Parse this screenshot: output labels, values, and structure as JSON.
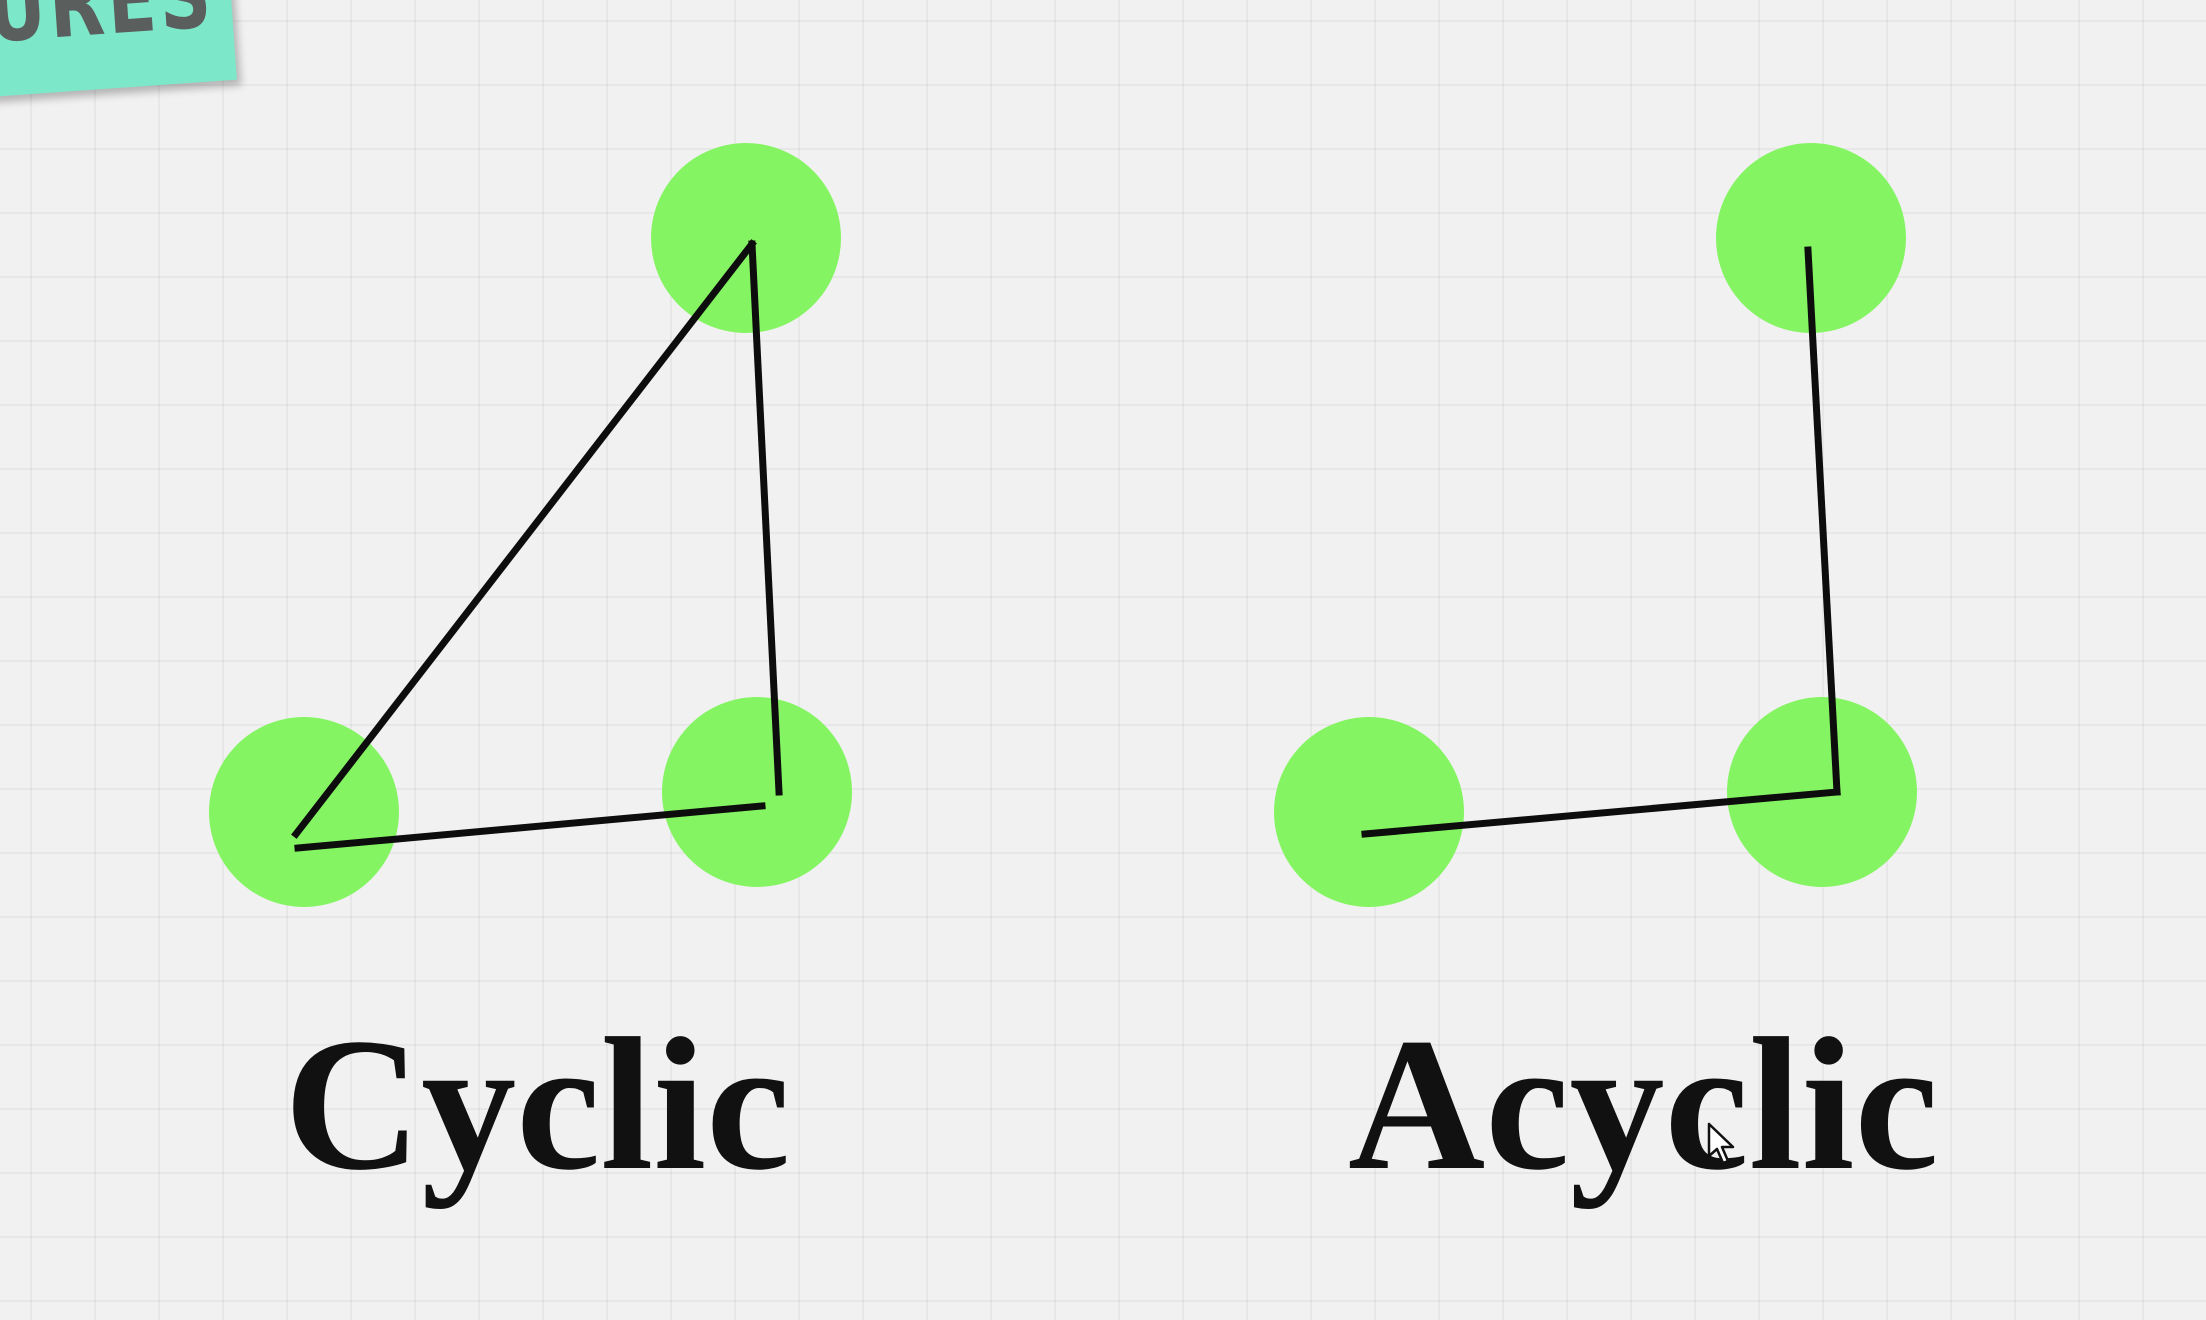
{
  "banner": {
    "text": "URES"
  },
  "diagrams": [
    {
      "label": "Cyclic"
    },
    {
      "label": "Acyclic"
    }
  ],
  "colors": {
    "node": "#85f463",
    "edge": "#0d0d0d",
    "banner": "#7de8c9",
    "background": "#f1f1f1"
  }
}
